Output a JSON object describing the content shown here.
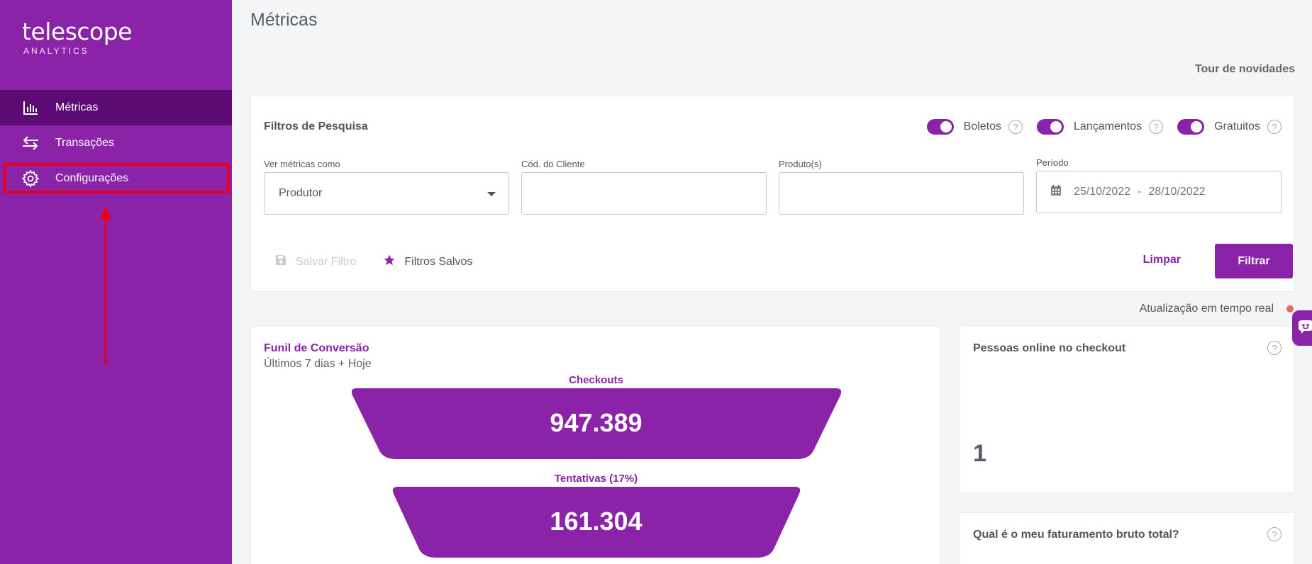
{
  "brand": {
    "name": "telescope",
    "sub": "ANALYTICS"
  },
  "sidebar": {
    "items": [
      {
        "label": "Métricas",
        "icon": "bar-chart-icon",
        "active": true
      },
      {
        "label": "Transações",
        "icon": "transfer-arrows-icon",
        "active": false
      },
      {
        "label": "Configurações",
        "icon": "gear-icon",
        "active": false
      }
    ]
  },
  "header": {
    "title": "Métricas",
    "tour_link": "Tour de novidades"
  },
  "filters": {
    "title": "Filtros de Pesquisa",
    "toggles": [
      {
        "label": "Boletos",
        "on": true
      },
      {
        "label": "Lançamentos",
        "on": true
      },
      {
        "label": "Gratuitos",
        "on": true
      }
    ],
    "view_as": {
      "label": "Ver métricas como",
      "value": "Produtor"
    },
    "client_code": {
      "label": "Cód. do Cliente",
      "value": ""
    },
    "products": {
      "label": "Produto(s)",
      "value": ""
    },
    "period": {
      "label": "Período",
      "start": "25/10/2022",
      "separator": "-",
      "end": "28/10/2022"
    },
    "save_filter_label": "Salvar Filtro",
    "saved_filters_label": "Filtros Salvos",
    "clear_label": "Limpar",
    "filter_label": "Filtrar"
  },
  "realtime": {
    "label": "Atualização em tempo real"
  },
  "funnel": {
    "title": "Funil de Conversão",
    "subtitle": "Últimos 7 dias + Hoje",
    "stages": [
      {
        "label": "Checkouts",
        "value": "947.389"
      },
      {
        "label": "Tentativas (17%)",
        "value": "161.304"
      }
    ]
  },
  "online_checkout": {
    "title": "Pessoas online no checkout",
    "value": "1"
  },
  "gross_revenue": {
    "title": "Qual é o meu faturamento bruto total?"
  },
  "colors": {
    "accent": "#8a23a8",
    "sidebar_active": "#5c0a74",
    "annotation": "#e8001c"
  }
}
